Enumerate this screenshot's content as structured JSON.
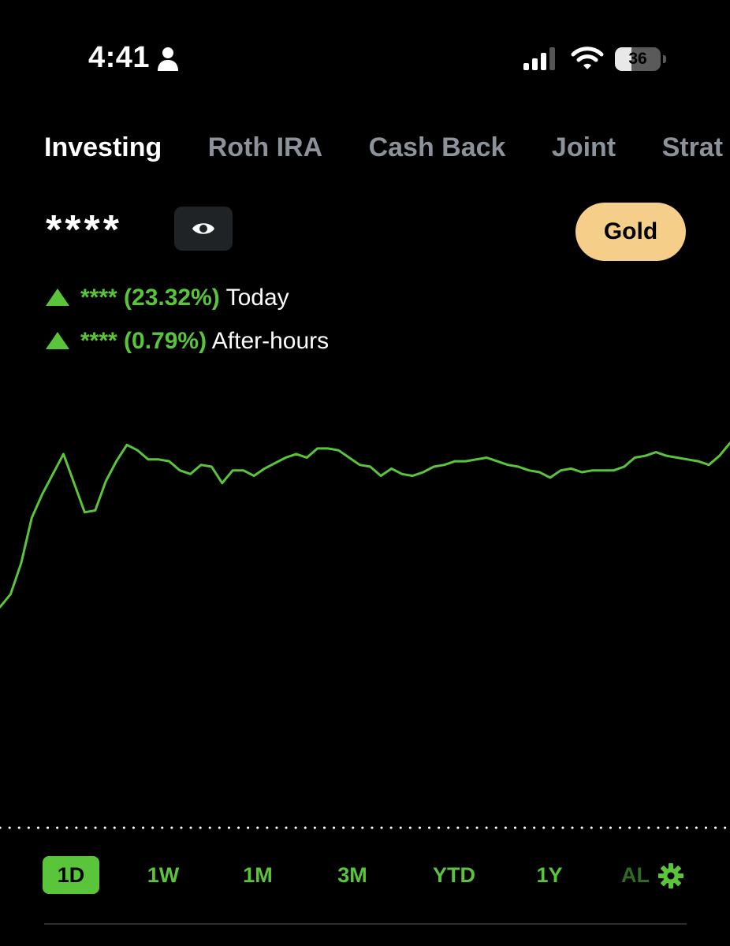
{
  "status_bar": {
    "time": "4:41",
    "battery_level": "36",
    "icons": [
      "person-icon",
      "signal-icon",
      "wifi-icon",
      "battery-icon"
    ]
  },
  "tabs": [
    {
      "label": "Investing",
      "active": true
    },
    {
      "label": "Roth IRA",
      "active": false
    },
    {
      "label": "Cash Back",
      "active": false
    },
    {
      "label": "Joint",
      "active": false
    },
    {
      "label": "Strat",
      "active": false
    }
  ],
  "portfolio": {
    "balance_masked": "****",
    "gold_label": "Gold",
    "today": {
      "value": "****",
      "percent": "(23.32%)",
      "label": "Today"
    },
    "after_hours": {
      "value": "****",
      "percent": "(0.79%)",
      "label": "After-hours"
    }
  },
  "range_selector": {
    "options": [
      "1D",
      "1W",
      "1M",
      "3M",
      "YTD",
      "1Y",
      "AL"
    ],
    "selected": "1D"
  },
  "colors": {
    "background": "#000000",
    "accent_green": "#5ac53b",
    "gold": "#f5cf8a",
    "tab_inactive": "#8b9299"
  },
  "chart_data": {
    "type": "line",
    "title": "",
    "xlabel": "",
    "ylabel": "",
    "grid": false,
    "reference_line": "dotted",
    "series": [
      {
        "values": [
          18,
          25,
          42,
          67,
          80,
          91,
          102,
          86,
          70,
          71,
          87,
          98,
          107,
          104,
          99,
          99,
          98,
          93,
          91,
          96,
          95,
          86,
          93,
          93,
          90,
          94,
          97,
          100,
          102,
          100,
          105,
          105,
          104,
          100,
          96,
          95,
          90,
          94,
          91,
          90,
          92,
          95,
          96,
          98,
          98,
          99,
          100,
          98,
          96,
          95,
          93,
          92,
          89,
          93,
          94,
          92,
          93,
          93,
          93,
          95,
          100,
          101,
          103,
          101,
          100,
          99,
          98,
          96,
          101,
          108
        ]
      }
    ]
  }
}
